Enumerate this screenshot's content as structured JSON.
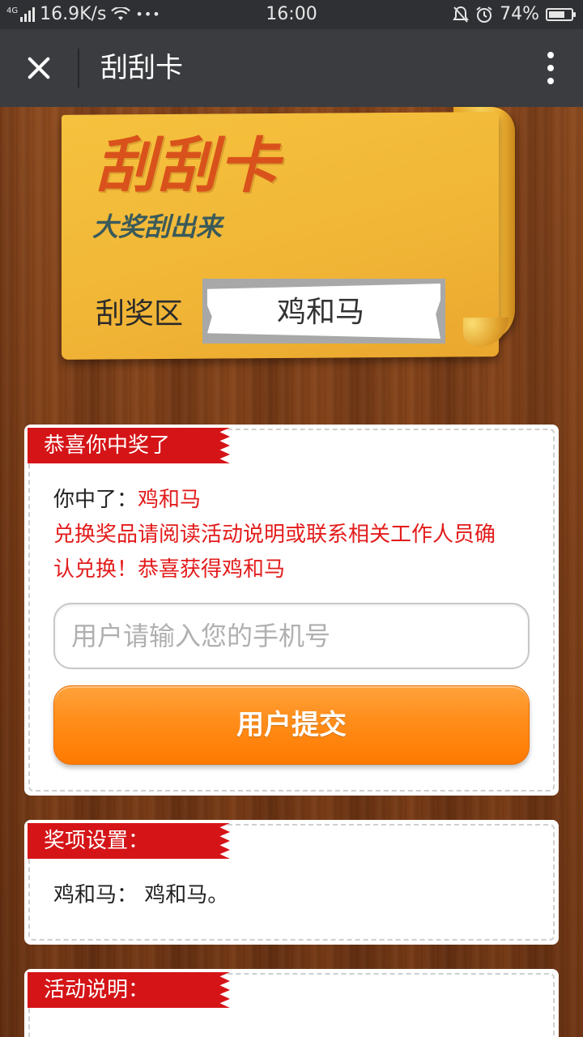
{
  "status_bar": {
    "network_type": "4G",
    "speed": "16.9K/s",
    "dots": "•••",
    "time": "16:00",
    "battery": "74%",
    "battery_level": 0.74
  },
  "title_bar": {
    "title": "刮刮卡"
  },
  "banner": {
    "title": "刮刮卡",
    "subtitle": "大奖刮出来",
    "scratch_label": "刮奖区",
    "prize_revealed": "鸡和马"
  },
  "win_panel": {
    "ribbon": "恭喜你中奖了",
    "won_prefix": "你中了：",
    "won_prize": "鸡和马",
    "notice_line1": "兑换奖品请阅读活动说明或联系相关工作人员确",
    "notice_line2": "认兑换！恭喜获得鸡和马",
    "phone_placeholder": "用户请输入您的手机号",
    "submit_label": "用户提交"
  },
  "prize_panel": {
    "ribbon": "奖项设置：",
    "item": "鸡和马： 鸡和马。"
  },
  "rules_panel": {
    "ribbon": "活动说明："
  },
  "colors": {
    "ribbon_red": "#d51417",
    "highlight_red": "#e31b1b",
    "button_orange": "#ff8d1a",
    "banner_yellow": "#f5c23e"
  },
  "icons": [
    "signal-icon",
    "wifi-icon",
    "silent-icon",
    "alarm-icon",
    "battery-icon",
    "close-icon",
    "more-icon"
  ]
}
